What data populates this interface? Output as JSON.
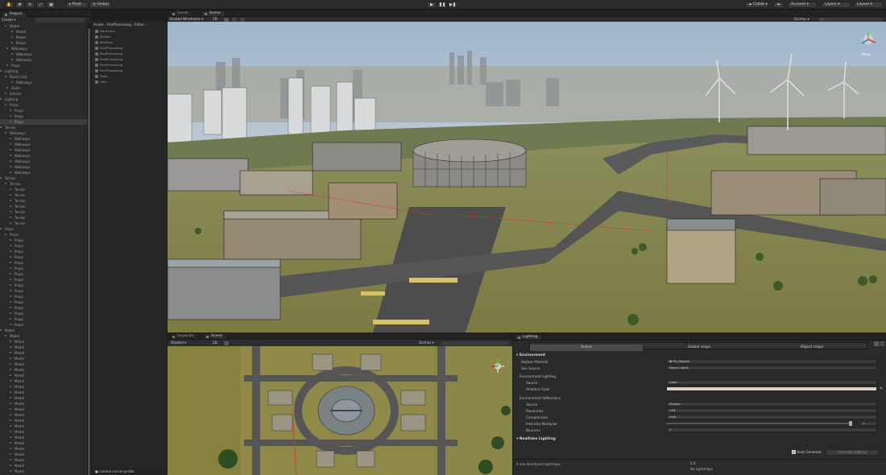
{
  "toolbar": {
    "tools": [
      "hand",
      "move",
      "rotate",
      "scale",
      "rect"
    ],
    "pivot_label": "Pivot",
    "global_label": "Global",
    "play_buttons": [
      "▶",
      "❚❚",
      "▶❚"
    ],
    "collab_label": "Collab",
    "account_label": "Account",
    "layers_label": "Layers",
    "layout_label": "Layout"
  },
  "hierarchy": {
    "tab_label": "Project",
    "create_label": "Create",
    "rows": [
      "Model",
      "Model",
      "Model",
      "Model",
      "Walkways",
      "Walkways",
      "Walkways",
      "Props",
      "Lighting",
      "Road Lines",
      "Walkways",
      "Static",
      "Interior",
      "Lighting",
      "Props",
      "Props",
      "Props",
      "Props",
      "Terrain",
      "Walkways",
      "Walkways",
      "Walkways",
      "Walkways",
      "Walkways",
      "Walkways",
      "Walkways",
      "Walkways",
      "Terrain",
      "Terrain",
      "Terrain",
      "Terrain",
      "Terrain",
      "Terrain",
      "Terrain",
      "Terrain",
      "Terrain",
      "Props",
      "Props",
      "Props",
      "Props",
      "Props",
      "Props",
      "Props",
      "Props",
      "Props",
      "Props",
      "Props",
      "Props",
      "Props",
      "Props",
      "Props",
      "Props",
      "Props",
      "Props",
      "Model",
      "Model",
      "Model",
      "Model",
      "Model",
      "Model",
      "Model",
      "Model",
      "Model",
      "Model",
      "Model",
      "Model",
      "Model",
      "Model",
      "Model",
      "Model",
      "Model",
      "Model",
      "Model",
      "Model",
      "Model",
      "Model",
      "Model",
      "Model",
      "Model",
      "Model",
      "Model"
    ]
  },
  "project": {
    "breadcrumb": "Assets › PostProcessing › Editor ›",
    "rows": [
      "Attributes",
      "Models",
      "Monitors",
      "PostProcessing",
      "PostProcessing",
      "PostProcessing",
      "PostProcessing",
      "PostProcessing",
      "Tools",
      "Utils"
    ]
  },
  "scene": {
    "game_tab": "Game",
    "scene_tab": "Scene",
    "shading_mode": "Shaded Wireframe",
    "dim_label": "2D",
    "gizmos_label": "Gizmos",
    "search_placeholder": "All",
    "persp_label": "Persp"
  },
  "inspector": {
    "inspector_tab": "Inspector",
    "scene_tab": "Scene",
    "shading_mode": "Shaded",
    "dim_label": "2D",
    "gizmos_label": "Gizmos",
    "prefab_label": "camera-carrier-prefab"
  },
  "lighting": {
    "tab_label": "Lighting",
    "toggle_scene": "Scene",
    "toggle_global_maps": "Global maps",
    "toggle_object_maps": "Object maps",
    "environment": "Environment",
    "skybox_label": "Skybox Material",
    "skybox_value": "Fill_Skybox",
    "sun_label": "Sun Source",
    "sun_value": "None (Light)",
    "env_lighting": "Environment Lighting",
    "source_label": "Source",
    "source_value": "Color",
    "ambient_label": "Ambient Color",
    "env_reflections": "Environment Reflections",
    "refl_source_label": "Source",
    "refl_source_value": "Skybox",
    "resolution_label": "Resolution",
    "resolution_value": "128",
    "compression_label": "Compression",
    "compression_value": "Auto",
    "intensity_label": "Intensity Multiplier",
    "intensity_value": "1",
    "bounces_label": "Bounces",
    "bounces_value": "1",
    "realtime_lighting": "Realtime Lighting",
    "auto_generate": "Auto Generate",
    "generate_lighting": "Generate Lighting",
    "non_directional": "0 non-directional lightmaps",
    "lightmap_size": "0 B",
    "no_lightmaps": "No Lightmaps"
  },
  "colors": {
    "accent": "#3a6fb0",
    "panel_bg": "#2a2a2a",
    "tab_bg": "#222222",
    "selected_row": "#3d3d3d"
  }
}
